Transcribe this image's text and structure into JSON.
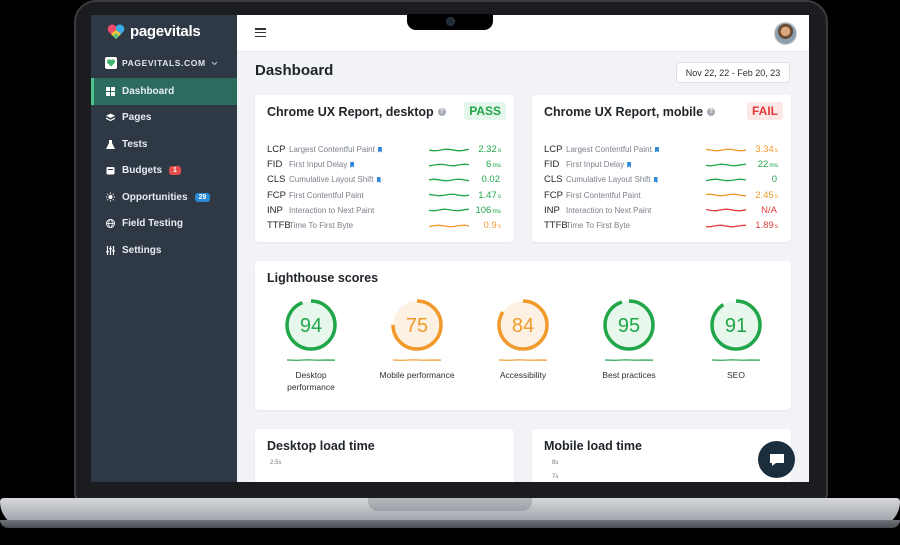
{
  "app": {
    "logo_text": "pagevitals",
    "site": "PAGEVITALS.COM"
  },
  "colors": {
    "good": "#21a64a",
    "needs_improvement": "#f19a2c",
    "poor": "#e23b3b",
    "sidebar": "#2f3946",
    "accent": "#4cc38a"
  },
  "sidebar": {
    "items": [
      {
        "label": "Dashboard",
        "icon": "dashboard-icon",
        "active": true
      },
      {
        "label": "Pages",
        "icon": "layers-icon"
      },
      {
        "label": "Tests",
        "icon": "flask-icon"
      },
      {
        "label": "Budgets",
        "icon": "budget-icon",
        "badge": "1"
      },
      {
        "label": "Opportunities",
        "icon": "sun-icon",
        "badge": "29"
      },
      {
        "label": "Field Testing",
        "icon": "globe-icon"
      },
      {
        "label": "Settings",
        "icon": "sliders-icon"
      }
    ]
  },
  "header": {
    "title": "Dashboard",
    "date_range": "Nov 22, 22 - Feb 20, 23"
  },
  "crux_desktop": {
    "title": "Chrome UX Report, desktop",
    "verdict": "PASS",
    "metrics": [
      {
        "abbr": "LCP",
        "name": "Largest Contentful Paint",
        "flag": true,
        "value": "2.32",
        "unit": "s",
        "status": "good"
      },
      {
        "abbr": "FID",
        "name": "First Input Delay",
        "flag": true,
        "value": "6",
        "unit": "ms",
        "status": "good"
      },
      {
        "abbr": "CLS",
        "name": "Cumulative Layout Shift",
        "flag": true,
        "value": "0.02",
        "unit": "",
        "status": "good"
      },
      {
        "abbr": "FCP",
        "name": "First Contentful Paint",
        "flag": false,
        "value": "1.47",
        "unit": "s",
        "status": "good"
      },
      {
        "abbr": "INP",
        "name": "Interaction to Next Paint",
        "flag": false,
        "value": "106",
        "unit": "ms",
        "status": "good"
      },
      {
        "abbr": "TTFB",
        "name": "Time To First Byte",
        "flag": false,
        "value": "0.9",
        "unit": "s",
        "status": "needs_improvement"
      }
    ]
  },
  "crux_mobile": {
    "title": "Chrome UX Report, mobile",
    "verdict": "FAIL",
    "metrics": [
      {
        "abbr": "LCP",
        "name": "Largest Contentful Paint",
        "flag": true,
        "value": "3.34",
        "unit": "s",
        "status": "needs_improvement"
      },
      {
        "abbr": "FID",
        "name": "First Input Delay",
        "flag": true,
        "value": "22",
        "unit": "ms",
        "status": "good"
      },
      {
        "abbr": "CLS",
        "name": "Cumulative Layout Shift",
        "flag": true,
        "value": "0",
        "unit": "",
        "status": "good"
      },
      {
        "abbr": "FCP",
        "name": "First Contentful Paint",
        "flag": false,
        "value": "2.45",
        "unit": "s",
        "status": "needs_improvement"
      },
      {
        "abbr": "INP",
        "name": "Interaction to Next Paint",
        "flag": false,
        "value": "N/A",
        "unit": "",
        "status": "poor"
      },
      {
        "abbr": "TTFB",
        "name": "Time To First Byte",
        "flag": false,
        "value": "1.89",
        "unit": "s",
        "status": "poor"
      }
    ]
  },
  "lighthouse": {
    "title": "Lighthouse scores",
    "scores": [
      {
        "value": 94,
        "label": "Desktop performance",
        "status": "good"
      },
      {
        "value": 75,
        "label": "Mobile performance",
        "status": "needs_improvement"
      },
      {
        "value": 84,
        "label": "Accessibility",
        "status": "needs_improvement"
      },
      {
        "value": 95,
        "label": "Best practices",
        "status": "good"
      },
      {
        "value": 91,
        "label": "SEO",
        "status": "good"
      }
    ]
  },
  "desktop_load": {
    "title": "Desktop load time",
    "axis_top": "2.5s"
  },
  "mobile_load": {
    "title": "Mobile load time",
    "axis_top": "8s",
    "axis_second": "7s"
  }
}
